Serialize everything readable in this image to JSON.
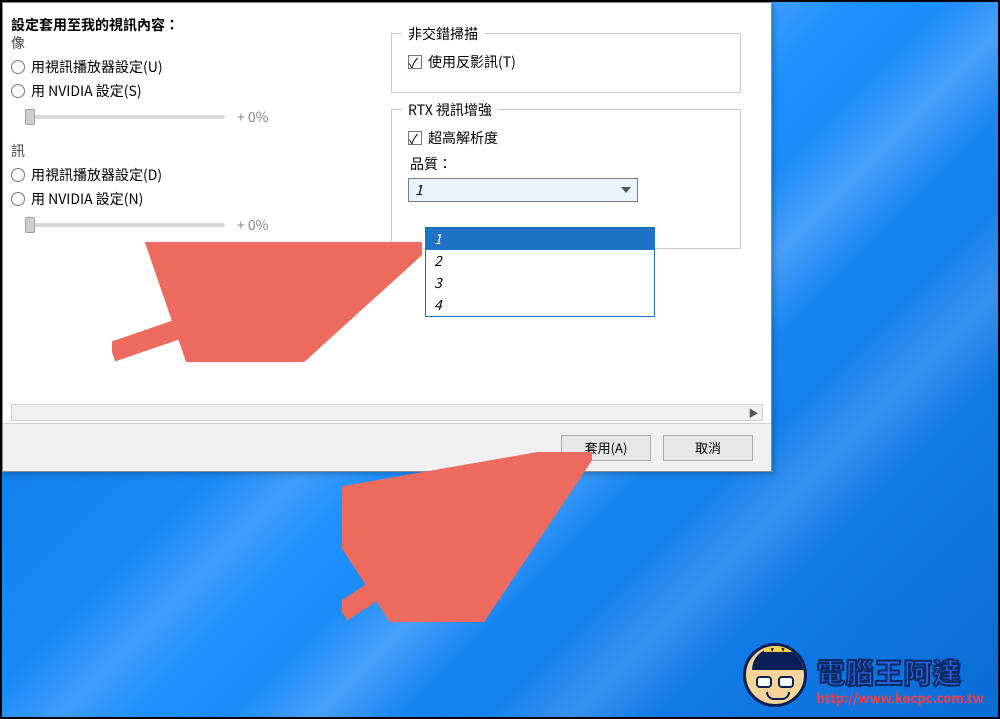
{
  "header": "設定套用至我的視訊內容：",
  "left": {
    "group1_label": "像",
    "g1_opt1": "用視訊播放器設定(U)",
    "g1_opt2": "用 NVIDIA 設定(S)",
    "slider1_value": "+ 0%",
    "group2_label": "訊",
    "g2_opt1": "用視訊播放器設定(D)",
    "g2_opt2": "用 NVIDIA 設定(N)",
    "slider2_value": "+ 0%"
  },
  "right": {
    "deint_legend": "非交錯掃描",
    "deint_opt": "使用反影訊(T)",
    "rtx_legend": "RTX 視訊增強",
    "rtx_opt": "超高解析度",
    "quality_label": "品質：",
    "quality_selected": "1",
    "quality_options": [
      "1",
      "2",
      "3",
      "4"
    ]
  },
  "buttons": {
    "apply": "套用(A)",
    "cancel": "取消"
  },
  "watermark": {
    "title": "電腦王阿達",
    "url": "http://www.kocpc.com.tw"
  },
  "colors": {
    "arrow": "#ed6a5e",
    "select_bg": "#1e73c8"
  }
}
